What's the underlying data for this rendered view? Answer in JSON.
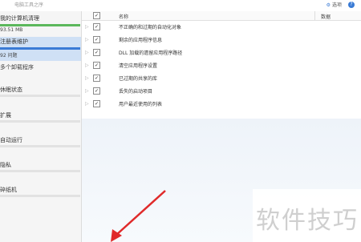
{
  "titlebar": {
    "title": "电脑工具之序",
    "options_label": "选项",
    "help_label": "?"
  },
  "sidebar": {
    "items": [
      {
        "label": "我的计算机清理",
        "sub": "93.51 MB",
        "progress": 1.0,
        "color": "#5cb85c"
      },
      {
        "label": "注册表维护",
        "sub": "92 问题",
        "sub2": "多个卸载程序",
        "progress": 1.0,
        "color": "#3a7bd5"
      },
      {
        "label": "休眠状态",
        "progress": 0
      },
      {
        "label": "扩展",
        "progress": 0
      },
      {
        "label": "自动运行",
        "progress": 0
      },
      {
        "label": "隐私",
        "progress": 0
      },
      {
        "label": "碎纸机",
        "progress": 0
      }
    ]
  },
  "table": {
    "col_name": "名称",
    "col_data": "数据",
    "rows": [
      {
        "label": "不正确的和过期的自动化对象",
        "checked": true
      },
      {
        "label": "剩余的应用程序信息",
        "checked": true
      },
      {
        "label": "DLL 加载的遗留应用程序路径",
        "checked": true
      },
      {
        "label": "清空应用程序设置",
        "checked": true
      },
      {
        "label": "已过期的共享的库",
        "checked": true
      },
      {
        "label": "丢失的启动项目",
        "checked": true
      },
      {
        "label": "用户最近使用的列表",
        "checked": true
      }
    ]
  },
  "watermark": {
    "text": "软件技巧"
  },
  "colors": {
    "accent": "#3a7bd5",
    "arrow": "#e02a2a"
  }
}
